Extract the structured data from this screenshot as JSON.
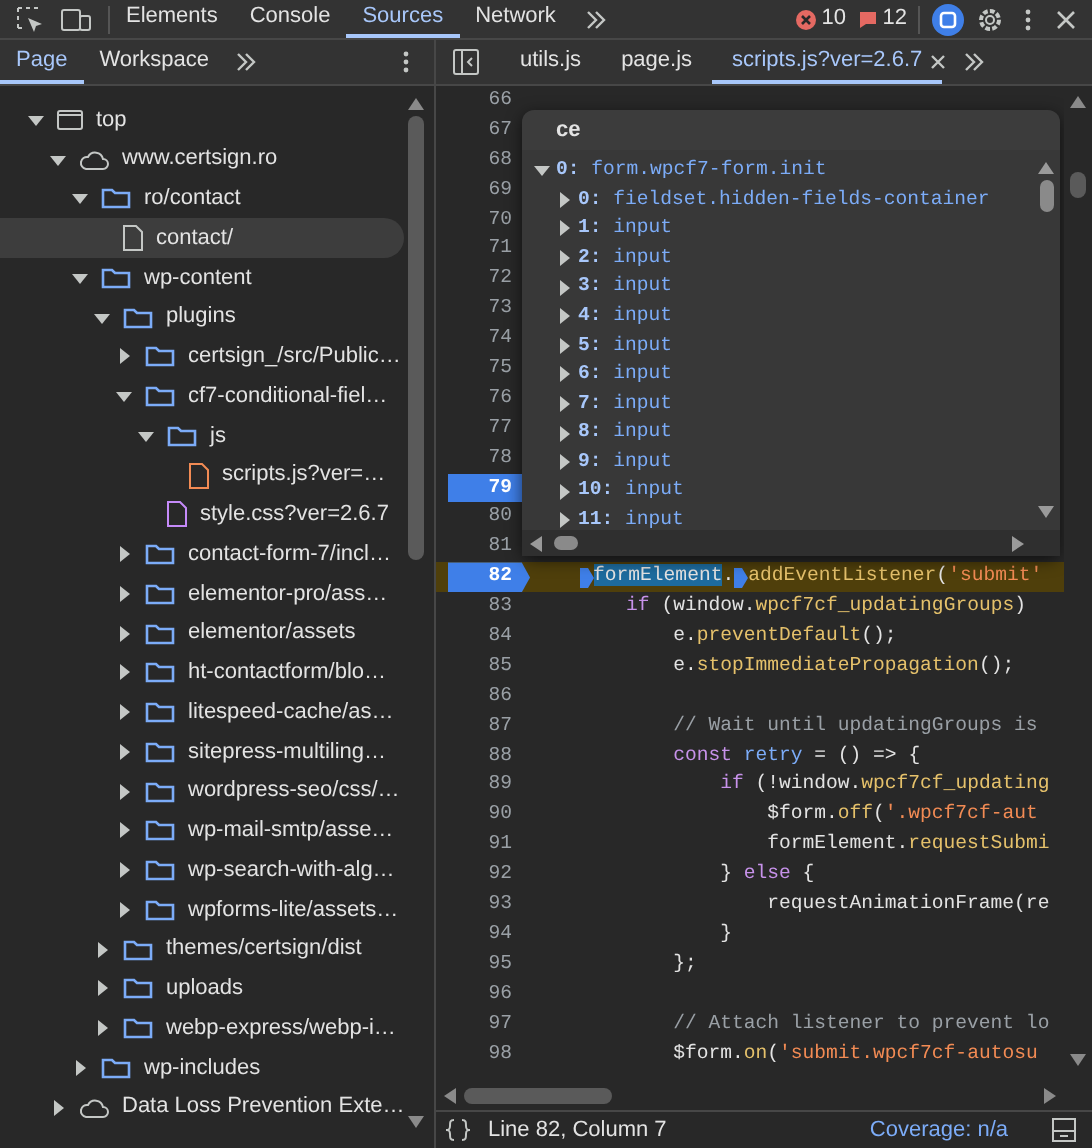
{
  "toolbar": {
    "tabs": [
      {
        "label": "Elements",
        "selected": false
      },
      {
        "label": "Console",
        "selected": false
      },
      {
        "label": "Sources",
        "selected": true
      },
      {
        "label": "Network",
        "selected": false
      }
    ],
    "errors": "10",
    "issues": "12"
  },
  "navigator": {
    "tabs": [
      {
        "label": "Page",
        "selected": true
      },
      {
        "label": "Workspace",
        "selected": false
      }
    ],
    "tree": [
      {
        "label": "top",
        "kind": "frame",
        "expanded": true,
        "selected": false,
        "children": [
          {
            "label": "www.certsign.ro",
            "kind": "cloud",
            "expanded": true,
            "selected": false,
            "children": [
              {
                "label": "ro/contact",
                "kind": "folder",
                "expanded": true,
                "selected": false,
                "children": [
                  {
                    "label": "contact/",
                    "kind": "file",
                    "selected": true
                  }
                ]
              },
              {
                "label": "wp-content",
                "kind": "folder",
                "expanded": true,
                "selected": false,
                "children": [
                  {
                    "label": "plugins",
                    "kind": "folder",
                    "expanded": true,
                    "selected": false,
                    "children": [
                      {
                        "label": "certsign_/src/Public…",
                        "kind": "folder",
                        "expanded": false,
                        "selected": false
                      },
                      {
                        "label": "cf7-conditional-fiel…",
                        "kind": "folder",
                        "expanded": true,
                        "selected": false,
                        "children": [
                          {
                            "label": "js",
                            "kind": "folder",
                            "expanded": true,
                            "selected": false,
                            "children": [
                              {
                                "label": "scripts.js?ver=…",
                                "kind": "script",
                                "selected": false
                              }
                            ]
                          },
                          {
                            "label": "style.css?ver=2.6.7",
                            "kind": "stylesheet",
                            "selected": false
                          }
                        ]
                      },
                      {
                        "label": "contact-form-7/incl…",
                        "kind": "folder",
                        "expanded": false,
                        "selected": false
                      },
                      {
                        "label": "elementor-pro/ass…",
                        "kind": "folder",
                        "expanded": false,
                        "selected": false
                      },
                      {
                        "label": "elementor/assets",
                        "kind": "folder",
                        "expanded": false,
                        "selected": false
                      },
                      {
                        "label": "ht-contactform/blo…",
                        "kind": "folder",
                        "expanded": false,
                        "selected": false
                      },
                      {
                        "label": "litespeed-cache/as…",
                        "kind": "folder",
                        "expanded": false,
                        "selected": false
                      },
                      {
                        "label": "sitepress-multiling…",
                        "kind": "folder",
                        "expanded": false,
                        "selected": false
                      },
                      {
                        "label": "wordpress-seo/css/…",
                        "kind": "folder",
                        "expanded": false,
                        "selected": false
                      },
                      {
                        "label": "wp-mail-smtp/asse…",
                        "kind": "folder",
                        "expanded": false,
                        "selected": false
                      },
                      {
                        "label": "wp-search-with-alg…",
                        "kind": "folder",
                        "expanded": false,
                        "selected": false
                      },
                      {
                        "label": "wpforms-lite/assets…",
                        "kind": "folder",
                        "expanded": false,
                        "selected": false
                      }
                    ]
                  },
                  {
                    "label": "themes/certsign/dist",
                    "kind": "folder",
                    "expanded": false,
                    "selected": false
                  },
                  {
                    "label": "uploads",
                    "kind": "folder",
                    "expanded": false,
                    "selected": false
                  },
                  {
                    "label": "webp-express/webp-i…",
                    "kind": "folder",
                    "expanded": false,
                    "selected": false
                  }
                ]
              },
              {
                "label": "wp-includes",
                "kind": "folder",
                "expanded": false,
                "selected": false
              }
            ]
          },
          {
            "label": "Data Loss Prevention Exte…",
            "kind": "cloud",
            "expanded": false,
            "selected": false
          }
        ]
      }
    ]
  },
  "editor": {
    "tabs": [
      {
        "label": "utils.js",
        "selected": false
      },
      {
        "label": "page.js",
        "selected": false
      },
      {
        "label": "scripts.js?ver=2.6.7",
        "selected": true
      }
    ],
    "lines": [
      {
        "number": "66",
        "breakpoint": false,
        "current": false
      },
      {
        "number": "67",
        "breakpoint": false,
        "current": false
      },
      {
        "number": "68",
        "breakpoint": false,
        "current": false
      },
      {
        "number": "69",
        "breakpoint": false,
        "current": false
      },
      {
        "number": "70",
        "breakpoint": false,
        "current": false
      },
      {
        "number": "71",
        "breakpoint": false,
        "current": false
      },
      {
        "number": "72",
        "breakpoint": false,
        "current": false
      },
      {
        "number": "73",
        "breakpoint": false,
        "current": false
      },
      {
        "number": "74",
        "breakpoint": false,
        "current": false
      },
      {
        "number": "75",
        "breakpoint": false,
        "current": false
      },
      {
        "number": "76",
        "breakpoint": false,
        "current": false
      },
      {
        "number": "77",
        "breakpoint": false,
        "current": false
      },
      {
        "number": "78",
        "breakpoint": false,
        "current": false
      },
      {
        "number": "79",
        "breakpoint": true,
        "current": false
      },
      {
        "number": "80",
        "breakpoint": false,
        "current": false
      },
      {
        "number": "81",
        "breakpoint": false,
        "current": false
      },
      {
        "number": "82",
        "breakpoint": true,
        "current": true,
        "tokens": [
          {
            "kind": "selection",
            "text": "    formElement",
            "marker": true
          },
          {
            "kind": "plain",
            "text": "."
          },
          {
            "kind": "function",
            "text": "addEventListener",
            "marker": true
          },
          {
            "kind": "plain",
            "text": "("
          },
          {
            "kind": "string",
            "text": "'submit'"
          }
        ]
      },
      {
        "number": "83",
        "breakpoint": false,
        "current": false,
        "tokens": [
          {
            "kind": "keyword",
            "text": "        if"
          },
          {
            "kind": "plain",
            "text": " (window."
          },
          {
            "kind": "function",
            "text": "wpcf7cf_updatingGroups"
          },
          {
            "kind": "plain",
            "text": ")"
          }
        ]
      },
      {
        "number": "84",
        "breakpoint": false,
        "current": false,
        "tokens": [
          {
            "kind": "plain",
            "text": "            e."
          },
          {
            "kind": "function",
            "text": "preventDefault"
          },
          {
            "kind": "plain",
            "text": "();"
          }
        ]
      },
      {
        "number": "85",
        "breakpoint": false,
        "current": false,
        "tokens": [
          {
            "kind": "plain",
            "text": "            e."
          },
          {
            "kind": "function",
            "text": "stopImmediatePropagation"
          },
          {
            "kind": "plain",
            "text": "();"
          }
        ]
      },
      {
        "number": "86",
        "breakpoint": false,
        "current": false
      },
      {
        "number": "87",
        "breakpoint": false,
        "current": false,
        "tokens": [
          {
            "kind": "comment",
            "text": "            // Wait until updatingGroups is"
          }
        ]
      },
      {
        "number": "88",
        "breakpoint": false,
        "current": false,
        "tokens": [
          {
            "kind": "keyword",
            "text": "            const"
          },
          {
            "kind": "variable",
            "text": " retry"
          },
          {
            "kind": "plain",
            "text": " = () => {"
          }
        ]
      },
      {
        "number": "89",
        "breakpoint": false,
        "current": false,
        "tokens": [
          {
            "kind": "keyword",
            "text": "                if"
          },
          {
            "kind": "plain",
            "text": " (!window."
          },
          {
            "kind": "function",
            "text": "wpcf7cf_updating"
          }
        ]
      },
      {
        "number": "90",
        "breakpoint": false,
        "current": false,
        "tokens": [
          {
            "kind": "plain",
            "text": "                    $form."
          },
          {
            "kind": "function",
            "text": "off"
          },
          {
            "kind": "plain",
            "text": "("
          },
          {
            "kind": "string",
            "text": "'.wpcf7cf-aut"
          }
        ]
      },
      {
        "number": "91",
        "breakpoint": false,
        "current": false,
        "tokens": [
          {
            "kind": "plain",
            "text": "                    formElement."
          },
          {
            "kind": "function",
            "text": "requestSubmi"
          }
        ]
      },
      {
        "number": "92",
        "breakpoint": false,
        "current": false,
        "tokens": [
          {
            "kind": "plain",
            "text": "                } "
          },
          {
            "kind": "keyword",
            "text": "else"
          },
          {
            "kind": "plain",
            "text": " {"
          }
        ]
      },
      {
        "number": "93",
        "breakpoint": false,
        "current": false,
        "tokens": [
          {
            "kind": "plain",
            "text": "                    requestAnimationFrame(re"
          }
        ]
      },
      {
        "number": "94",
        "breakpoint": false,
        "current": false,
        "tokens": [
          {
            "kind": "plain",
            "text": "                }"
          }
        ]
      },
      {
        "number": "95",
        "breakpoint": false,
        "current": false,
        "tokens": [
          {
            "kind": "plain",
            "text": "            };"
          }
        ]
      },
      {
        "number": "96",
        "breakpoint": false,
        "current": false
      },
      {
        "number": "97",
        "breakpoint": false,
        "current": false,
        "tokens": [
          {
            "kind": "comment",
            "text": "            // Attach listener to prevent lo"
          }
        ]
      },
      {
        "number": "98",
        "breakpoint": false,
        "current": false,
        "tokens": [
          {
            "kind": "plain",
            "text": "            $form."
          },
          {
            "kind": "function",
            "text": "on"
          },
          {
            "kind": "plain",
            "text": "("
          },
          {
            "kind": "string",
            "text": "'submit.wpcf7cf-autosu"
          }
        ]
      }
    ],
    "popover": {
      "title": "ce",
      "entries": [
        {
          "key": "0:",
          "value": "form.wpcf7-form.init",
          "expanded": true,
          "children": [
            {
              "key": "0:",
              "value": "fieldset.hidden-fields-container",
              "expanded": false
            },
            {
              "key": "1:",
              "value": "input",
              "expanded": false
            },
            {
              "key": "2:",
              "value": "input",
              "expanded": false
            },
            {
              "key": "3:",
              "value": "input",
              "expanded": false
            },
            {
              "key": "4:",
              "value": "input",
              "expanded": false
            },
            {
              "key": "5:",
              "value": "input",
              "expanded": false
            },
            {
              "key": "6:",
              "value": "input",
              "expanded": false
            },
            {
              "key": "7:",
              "value": "input",
              "expanded": false
            },
            {
              "key": "8:",
              "value": "input",
              "expanded": false
            },
            {
              "key": "9:",
              "value": "input",
              "expanded": false
            },
            {
              "key": "10:",
              "value": "input",
              "expanded": false
            },
            {
              "key": "11:",
              "value": "input",
              "expanded": false
            }
          ]
        }
      ]
    }
  },
  "status_bar": {
    "position": "Line 82, Column 7",
    "coverage": "Coverage: n/a"
  }
}
